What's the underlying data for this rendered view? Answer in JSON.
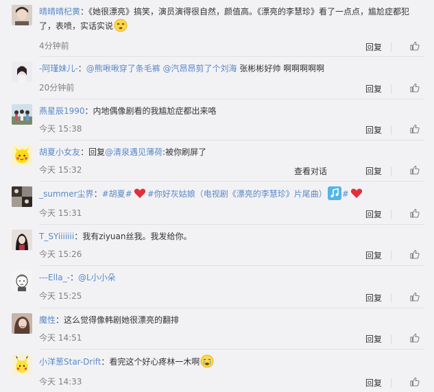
{
  "comments": [
    {
      "user": "晴晴晴杞黄",
      "segments": [
        {
          "t": "：《她很漂亮》搞笑，演员演得很自然，颜值高。《漂亮的李慧珍》看了一点点，尴尬症都犯"
        },
        {
          "t": "了，表喷，实话实说"
        }
      ],
      "emoji": "dizzy-face",
      "time": "4分钟前",
      "reply": "回复"
    },
    {
      "user": "-阿瑾妹儿-",
      "segments": [
        {
          "t": "："
        },
        {
          "t": "@熊啾啾穿了条毛裤",
          "cls": "mention"
        },
        {
          "t": " "
        },
        {
          "t": "@汽昂昂剪了个刘海",
          "cls": "mention"
        },
        {
          "t": " 张彬彬好帅 啊啊啊啊啊"
        }
      ],
      "time": "20分钟前",
      "reply": "回复"
    },
    {
      "user": "燕星辰1990",
      "segments": [
        {
          "t": "：内地偶像剧看的我尴尬症都出来咯"
        }
      ],
      "time": "今天 15:38",
      "reply": "回复"
    },
    {
      "user": "胡夏小女友",
      "segments": [
        {
          "t": "：回复"
        },
        {
          "t": "@清泉遇见薄荷",
          "cls": "mention"
        },
        {
          "t": ":被你刷屏了"
        }
      ],
      "time": "今天 15:32",
      "conversation": "查看对话",
      "reply": "回复"
    },
    {
      "user": "_summer尘界",
      "segments": [
        {
          "t": "："
        },
        {
          "t": "#胡夏#",
          "cls": "topic"
        }
      ],
      "segments2": [
        {
          "t": "#你好灰姑娘（电视剧《漂亮的李慧珍》片尾曲）",
          "cls": "topic"
        }
      ],
      "segments3": [
        {
          "t": "#",
          "cls": "topic"
        }
      ],
      "time": "今天 15:31",
      "reply": "回复"
    },
    {
      "user": "T_SYiiiiiii",
      "segments": [
        {
          "t": "：我有ziyuan丝我。我发给你。"
        }
      ],
      "time": "今天 15:26",
      "reply": "回复"
    },
    {
      "user": "---Ella_-",
      "segments": [
        {
          "t": "："
        },
        {
          "t": "@L小小朵",
          "cls": "mention"
        }
      ],
      "time": "今天 15:25",
      "reply": "回复"
    },
    {
      "user": "魔性",
      "segments": [
        {
          "t": "：这么觉得像韩剧她很漂亮的翻排"
        }
      ],
      "time": "今天 14:51",
      "reply": "回复"
    },
    {
      "user": "小洋葱Star-Drift",
      "segments": [
        {
          "t": "：看完这个好心疼林一木啊"
        }
      ],
      "emoji": "crying-face",
      "time": "今天 14:33",
      "reply": "回复"
    }
  ],
  "colors": {
    "link": "#5a88c6",
    "text": "#333333",
    "time": "#808080",
    "background": "#f2f2f5",
    "heart": "#e0303a"
  }
}
